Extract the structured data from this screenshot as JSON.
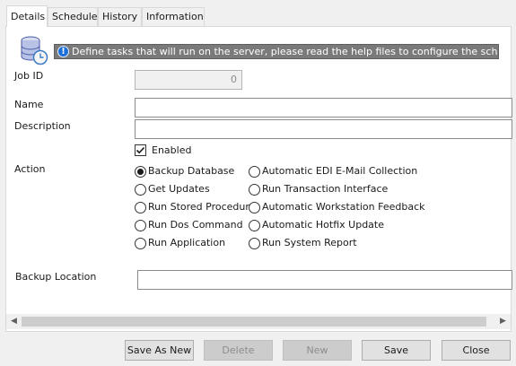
{
  "tabs": [
    {
      "label": "Details",
      "active": true
    },
    {
      "label": "Schedule"
    },
    {
      "label": "History"
    },
    {
      "label": "Information"
    }
  ],
  "info_bar": {
    "icon": "info-icon",
    "text": "Define tasks that will run on the server, please read the help files to configure the scheduler"
  },
  "form": {
    "job_id_label": "Job ID",
    "job_id_value": "0",
    "name_label": "Name",
    "name_value": "",
    "description_label": "Description",
    "description_value": "",
    "enabled_label": "Enabled",
    "enabled_checked": true,
    "action_label": "Action",
    "backup_location_label": "Backup Location",
    "backup_location_value": ""
  },
  "actions": {
    "col1": [
      "Backup Database",
      "Get Updates",
      "Run Stored Procedure",
      "Run Dos Command",
      "Run Application"
    ],
    "col2": [
      "Automatic EDI E-Mail Collection",
      "Run Transaction Interface",
      "Automatic Workstation Feedback",
      "Automatic Hotfix Update",
      "Run System Report"
    ],
    "selected": "Backup Database"
  },
  "buttons": {
    "save_as_new": "Save As New",
    "delete": "Delete",
    "new": "New",
    "save": "Save",
    "close": "Close"
  }
}
